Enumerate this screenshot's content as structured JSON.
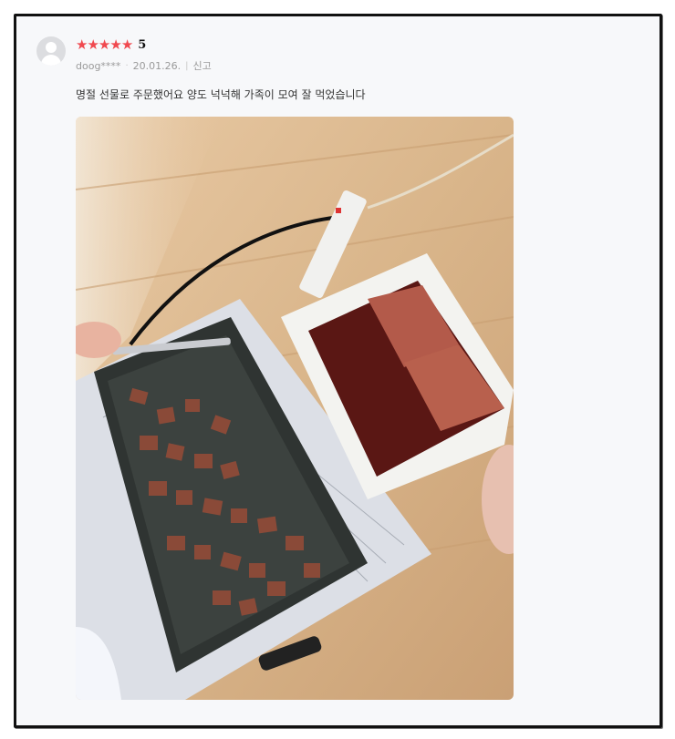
{
  "review": {
    "rating_value": "5",
    "stars": [
      "★",
      "★",
      "★",
      "★",
      "★"
    ],
    "author": "doog****",
    "dot": "·",
    "date": "20.01.26.",
    "divider": "|",
    "report_label": "신고",
    "content": "명절 선물로 주문했어요 양도 넉넉해 가족이 모여 잘 먹었습니다",
    "star_color": "#f0494f",
    "photo_icon": "food-photo"
  }
}
